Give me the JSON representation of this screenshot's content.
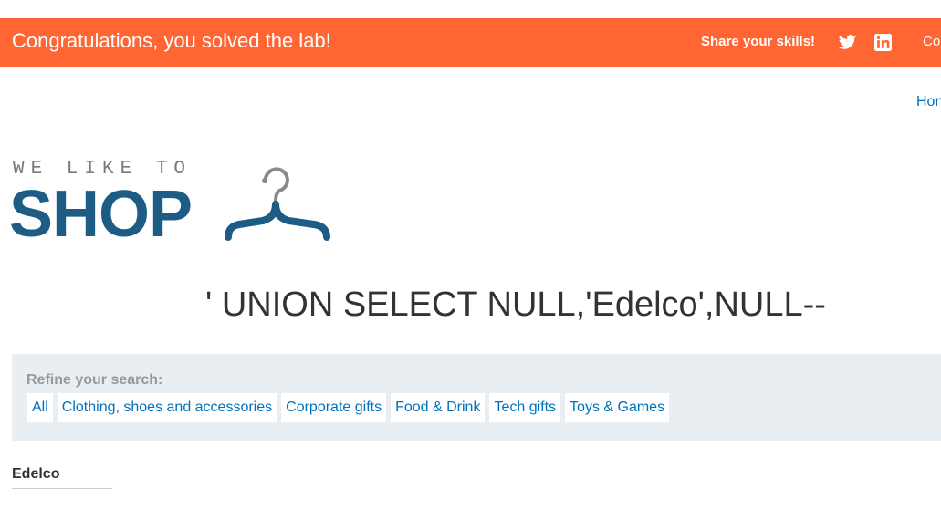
{
  "banner": {
    "message": "Congratulations, you solved the lab!",
    "share_label": "Share your skills!",
    "cut_text": "Co",
    "color": "#ff6633"
  },
  "nav": {
    "home_text": "Hon"
  },
  "logo": {
    "tagline": "WE LIKE TO",
    "word": "SHOP",
    "icon": "hanger-icon"
  },
  "search": {
    "heading": "' UNION SELECT NULL,'Edelco',NULL--"
  },
  "filters": {
    "title": "Refine your search:",
    "items": [
      {
        "label": "All"
      },
      {
        "label": "Clothing, shoes and accessories"
      },
      {
        "label": "Corporate gifts"
      },
      {
        "label": "Food & Drink"
      },
      {
        "label": "Tech gifts"
      },
      {
        "label": "Toys & Games"
      }
    ]
  },
  "results": [
    {
      "name": "Edelco"
    }
  ],
  "colors": {
    "accent": "#ff6633",
    "link": "#0071bc",
    "brand": "#1d5c84",
    "panel": "#e8eef1"
  }
}
